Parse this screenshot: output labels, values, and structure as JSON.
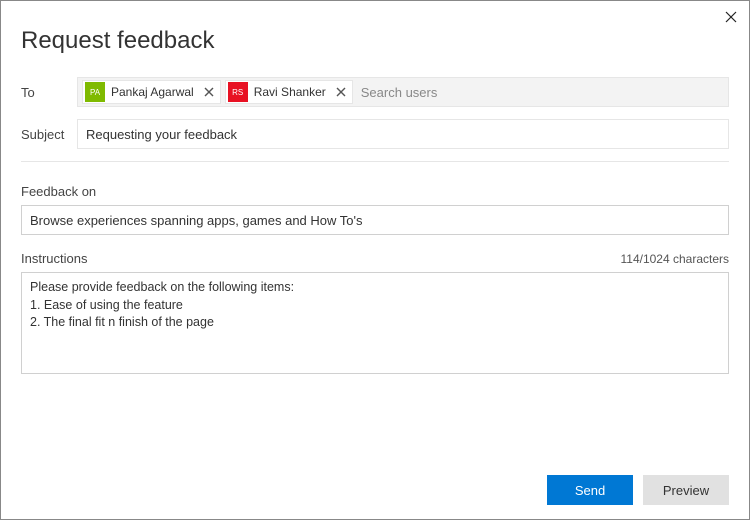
{
  "title": "Request feedback",
  "labels": {
    "to": "To",
    "subject": "Subject",
    "feedbackOn": "Feedback on",
    "instructions": "Instructions"
  },
  "to": {
    "placeholder": "Search users",
    "recipients": [
      {
        "name": "Pankaj Agarwal",
        "initials": "PA",
        "color": "#7fba00"
      },
      {
        "name": "Ravi Shanker",
        "initials": "RS",
        "color": "#e81123"
      }
    ]
  },
  "subject": {
    "value": "Requesting your feedback"
  },
  "feedbackOn": {
    "value": "Browse experiences spanning apps, games and How To's"
  },
  "instructions": {
    "value": "Please provide feedback on the following items:\n1. Ease of using the feature\n2. The final fit n finish of the page",
    "counter": "114/1024 characters"
  },
  "buttons": {
    "send": "Send",
    "preview": "Preview"
  }
}
